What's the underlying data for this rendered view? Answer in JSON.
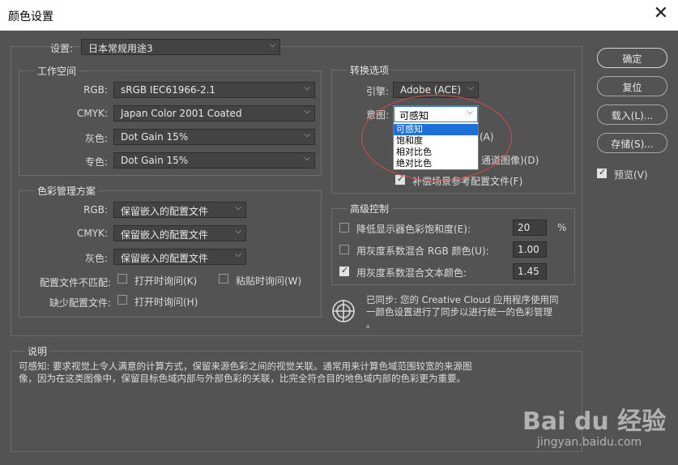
{
  "window": {
    "title": "颜色设置",
    "close": "✕"
  },
  "settings": {
    "label": "设置:",
    "value": "日本常规用途3"
  },
  "workspace": {
    "legend": "工作空间",
    "rgb_label": "RGB:",
    "rgb_value": "sRGB IEC61966-2.1",
    "cmyk_label": "CMYK:",
    "cmyk_value": "Japan Color 2001 Coated",
    "gray_label": "灰色:",
    "gray_value": "Dot Gain 15%",
    "spot_label": "专色:",
    "spot_value": "Dot Gain 15%"
  },
  "policies": {
    "legend": "色彩管理方案",
    "rgb_label": "RGB:",
    "rgb_value": "保留嵌入的配置文件",
    "cmyk_label": "CMYK:",
    "cmyk_value": "保留嵌入的配置文件",
    "gray_label": "灰色:",
    "gray_value": "保留嵌入的配置文件",
    "mismatch_label": "配置文件不匹配:",
    "mismatch_open": "打开时询问(K)",
    "mismatch_paste": "粘贴时询问(W)",
    "missing_label": "缺少配置文件:",
    "missing_open": "打开时询问(H)"
  },
  "conversion": {
    "legend": "转换选项",
    "engine_label": "引擎:",
    "engine_value": "Adobe (ACE)",
    "intent_label": "意图:",
    "intent_value": "可感知",
    "intent_options": [
      "可感知",
      "饱和度",
      "相对比色",
      "绝对比色"
    ],
    "opt1_tail": "(A)",
    "opt2_tail": "通道图像)(D)",
    "compensate": "补偿场景参考配置文件(F)"
  },
  "advanced": {
    "legend": "高级控制",
    "desaturate_label": "降低显示器色彩饱和度(E):",
    "desaturate_value": "20",
    "desaturate_unit": "%",
    "blend_rgb_label": "用灰度系数混合 RGB 颜色(U):",
    "blend_rgb_value": "1.00",
    "blend_text_label": "用灰度系数混合文本颜色:",
    "blend_text_value": "1.45"
  },
  "sync": {
    "line1": "已同步: 您的 Creative Cloud 应用程序使用同",
    "line2": "一颜色设置进行了同步以进行统一的色彩管理",
    "line3": "。"
  },
  "description": {
    "legend": "说明",
    "line1": "可感知: 要求视觉上令人满意的计算方式，保留来源色彩之间的视觉关联。通常用来计算色域范围较宽的来源图",
    "line2": "像，因为在这类图像中，保留目标色域内部与外部色彩的关联，比完全符合目的地色域内部的色彩更为重要。"
  },
  "buttons": {
    "ok": "确定",
    "reset": "复位",
    "load": "载入(L)...",
    "save": "存储(S)...",
    "preview": "预览(V)"
  },
  "watermark": {
    "brand": "Bai du 经验",
    "url": "jingyan.baidu.com"
  }
}
